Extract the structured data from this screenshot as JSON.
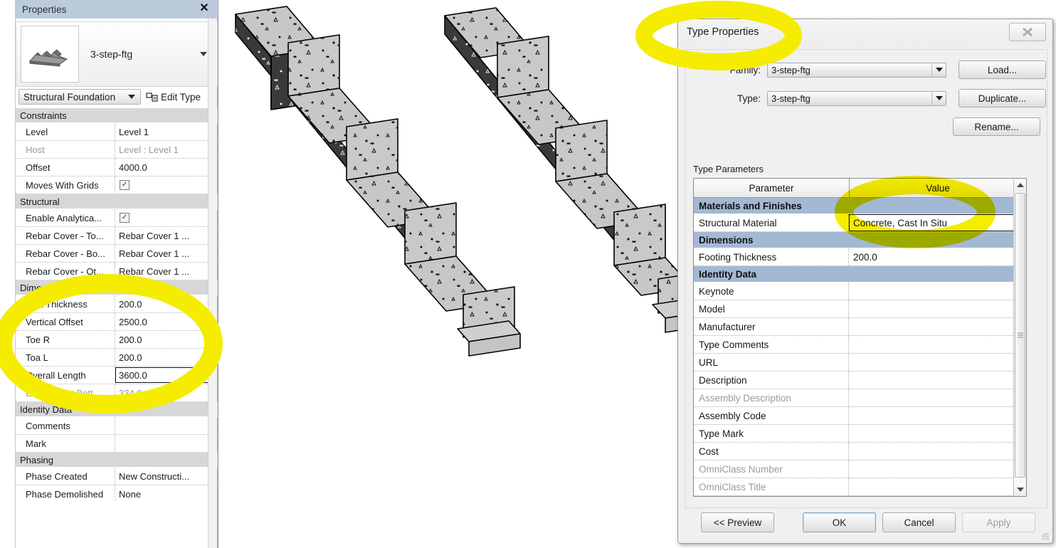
{
  "properties_panel": {
    "title": "Properties",
    "close_icon": "close-icon",
    "type_name": "3-step-ftg",
    "category": "Structural Foundation",
    "edit_type_label": "Edit Type",
    "sections": [
      {
        "name": "Constraints",
        "rows": [
          {
            "key": "Level",
            "value": "Level 1",
            "dim": false,
            "kind": "text"
          },
          {
            "key": "Host",
            "value": "Level : Level 1",
            "dim": true,
            "kind": "text"
          },
          {
            "key": "Offset",
            "value": "4000.0",
            "dim": false,
            "kind": "text"
          },
          {
            "key": "Moves With Grids",
            "value": "",
            "dim": false,
            "kind": "checkbox"
          }
        ]
      },
      {
        "name": "Structural",
        "rows": [
          {
            "key": "Enable Analytica...",
            "value": "",
            "dim": false,
            "kind": "checkbox"
          },
          {
            "key": "Rebar Cover - To...",
            "value": "Rebar Cover 1 ...",
            "dim": false,
            "kind": "text"
          },
          {
            "key": "Rebar Cover - Bo...",
            "value": "Rebar Cover 1 ...",
            "dim": false,
            "kind": "text"
          },
          {
            "key": "Rebar Cover - Ot...",
            "value": "Rebar Cover 1 ...",
            "dim": false,
            "kind": "text"
          }
        ]
      },
      {
        "name": "Dimensions",
        "rows": [
          {
            "key": "Wall Thickness",
            "value": "200.0",
            "dim": false,
            "kind": "text"
          },
          {
            "key": "Vertical Offset",
            "value": "2500.0",
            "dim": false,
            "kind": "text"
          },
          {
            "key": "Toe R",
            "value": "200.0",
            "dim": false,
            "kind": "text"
          },
          {
            "key": "Toa L",
            "value": "200.0",
            "dim": false,
            "kind": "text"
          },
          {
            "key": "Overall Length",
            "value": "3600.0",
            "dim": false,
            "kind": "boxed"
          },
          {
            "key": "Elevation at Bott...",
            "value": "334.8",
            "dim": true,
            "kind": "text"
          }
        ]
      },
      {
        "name": "Identity Data",
        "rows": [
          {
            "key": "Comments",
            "value": "",
            "dim": false,
            "kind": "text"
          },
          {
            "key": "Mark",
            "value": "",
            "dim": false,
            "kind": "text"
          }
        ]
      },
      {
        "name": "Phasing",
        "rows": [
          {
            "key": "Phase Created",
            "value": "New Constructi...",
            "dim": false,
            "kind": "text"
          },
          {
            "key": "Phase Demolished",
            "value": "None",
            "dim": false,
            "kind": "text"
          }
        ]
      }
    ]
  },
  "type_properties_dialog": {
    "title": "Type Properties",
    "close_icon": "close-icon",
    "family_label": "Family:",
    "family_value": "3-step-ftg",
    "type_label": "Type:",
    "type_value": "3-step-ftg",
    "load_button": "Load...",
    "duplicate_button": "Duplicate...",
    "rename_button": "Rename...",
    "type_parameters_caption": "Type Parameters",
    "table": {
      "columns": [
        "Parameter",
        "Value"
      ],
      "sections": [
        {
          "name": "Materials and Finishes",
          "rows": [
            {
              "parameter": "Structural Material",
              "value": "Concrete, Cast In Situ",
              "dim": false,
              "boxed": true
            }
          ]
        },
        {
          "name": "Dimensions",
          "rows": [
            {
              "parameter": "Footing Thickness",
              "value": "200.0",
              "dim": false,
              "boxed": false
            }
          ]
        },
        {
          "name": "Identity Data",
          "rows": [
            {
              "parameter": "Keynote",
              "value": "",
              "dim": false,
              "boxed": false
            },
            {
              "parameter": "Model",
              "value": "",
              "dim": false,
              "boxed": false
            },
            {
              "parameter": "Manufacturer",
              "value": "",
              "dim": false,
              "boxed": false
            },
            {
              "parameter": "Type Comments",
              "value": "",
              "dim": false,
              "boxed": false
            },
            {
              "parameter": "URL",
              "value": "",
              "dim": false,
              "boxed": false
            },
            {
              "parameter": "Description",
              "value": "",
              "dim": false,
              "boxed": false
            },
            {
              "parameter": "Assembly Description",
              "value": "",
              "dim": true,
              "boxed": false
            },
            {
              "parameter": "Assembly Code",
              "value": "",
              "dim": false,
              "boxed": false
            },
            {
              "parameter": "Type Mark",
              "value": "",
              "dim": false,
              "boxed": false
            },
            {
              "parameter": "Cost",
              "value": "",
              "dim": false,
              "boxed": false
            },
            {
              "parameter": "OmniClass Number",
              "value": "",
              "dim": true,
              "boxed": false
            },
            {
              "parameter": "OmniClass Title",
              "value": "",
              "dim": true,
              "boxed": false
            }
          ]
        }
      ]
    },
    "footer": {
      "preview_button": "<< Preview",
      "ok_button": "OK",
      "cancel_button": "Cancel",
      "apply_button": "Apply"
    }
  },
  "viewport": {
    "model_description": "Two isometric stepped concrete strip footings, 3 steps each, shaded light gray top/front faces and dark gray side faces with speckled concrete hatch",
    "objects": [
      {
        "name": "stepped-footing-left",
        "steps": 3
      },
      {
        "name": "stepped-footing-right",
        "steps": 3
      }
    ]
  },
  "annotations": {
    "highlighter_color": "#f5ec00",
    "marks": [
      {
        "name": "highlight-dimensions-group",
        "target": "properties Dimensions section"
      },
      {
        "name": "highlight-type-properties-title",
        "target": "Type Properties title bar"
      },
      {
        "name": "highlight-structural-material-value",
        "target": "Structural Material value cell"
      }
    ]
  }
}
